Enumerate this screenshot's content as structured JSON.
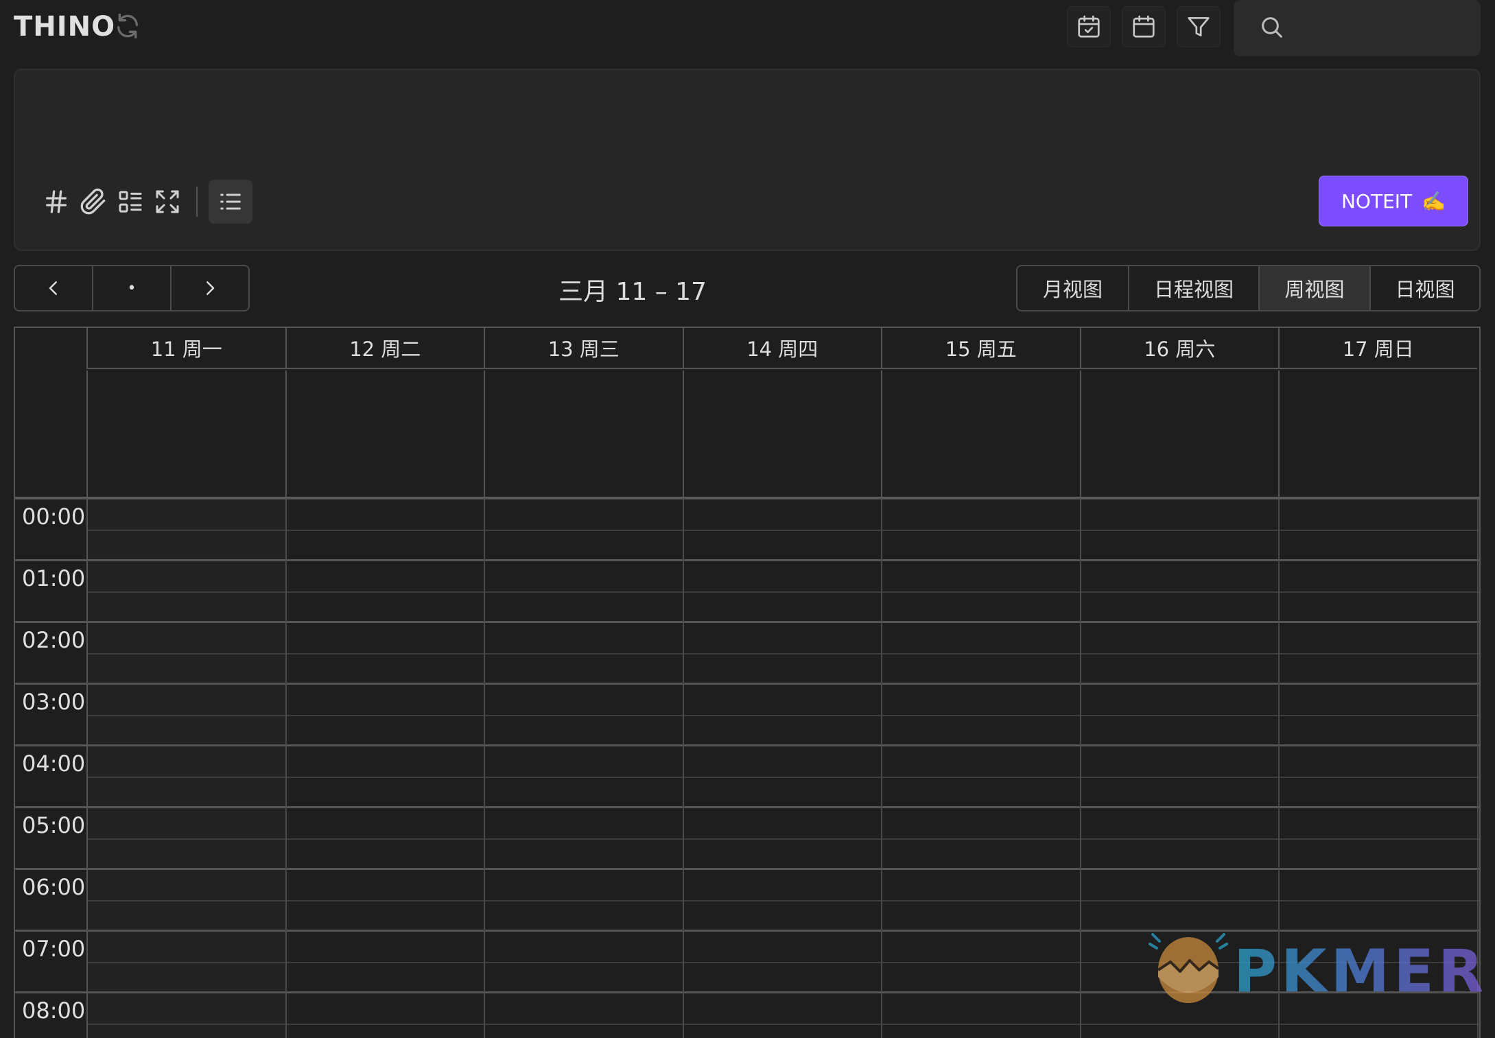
{
  "app": {
    "title": "THINO"
  },
  "header": {
    "search": {
      "placeholder": ""
    }
  },
  "editor": {
    "placeholder": "",
    "submit_label": "NOTEIT",
    "submit_emoji": "✍️"
  },
  "calendar": {
    "nav": {
      "prev": "‹",
      "today": "•",
      "next": "›"
    },
    "range_title": "三月 11 – 17",
    "views": [
      {
        "label": "月视图",
        "active": false
      },
      {
        "label": "日程视图",
        "active": false
      },
      {
        "label": "周视图",
        "active": true
      },
      {
        "label": "日视图",
        "active": false
      }
    ],
    "days": [
      "11 周一",
      "12 周二",
      "13 周三",
      "14 周四",
      "15 周五",
      "16 周六",
      "17 周日"
    ],
    "hours": [
      "00:00",
      "01:00",
      "02:00",
      "03:00",
      "04:00",
      "05:00",
      "06:00",
      "07:00",
      "08:00"
    ]
  },
  "watermark": {
    "text": "PKMER"
  },
  "colors": {
    "accent": "#7c4dff",
    "background": "#1e1e1e",
    "panel": "#262626"
  }
}
